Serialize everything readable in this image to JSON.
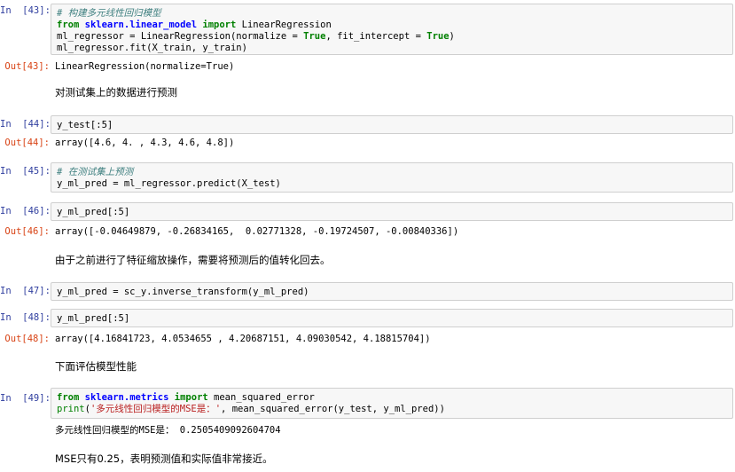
{
  "cells": {
    "c43": {
      "in_prompt": "In  [43]:",
      "line1_comment": "# 构建多元线性回归模型",
      "line2_from": "from",
      "line2_module": "sklearn.linear_model",
      "line2_import": "import",
      "line2_name": " LinearRegression",
      "line3_a": "ml_regressor = LinearRegression(normalize = ",
      "line3_true1": "True",
      "line3_b": ", fit_intercept = ",
      "line3_true2": "True",
      "line3_c": ")",
      "line4": "ml_regressor.fit(X_train, y_train)",
      "out_prompt": "Out[43]:",
      "output": "LinearRegression(normalize=True)"
    },
    "md1": "对测试集上的数据进行预测",
    "c44": {
      "in_prompt": "In  [44]:",
      "code": "y_test[:5]",
      "out_prompt": "Out[44]:",
      "output": "array([4.6, 4. , 4.3, 4.6, 4.8])"
    },
    "c45": {
      "in_prompt": "In  [45]:",
      "line1_comment": "# 在测试集上预测",
      "line2": "y_ml_pred = ml_regressor.predict(X_test)"
    },
    "c46": {
      "in_prompt": "In  [46]:",
      "code": "y_ml_pred[:5]",
      "out_prompt": "Out[46]:",
      "output": "array([-0.04649879, -0.26834165,  0.02771328, -0.19724507, -0.00840336])"
    },
    "md2": "由于之前进行了特征缩放操作，需要将预测后的值转化回去。",
    "c47": {
      "in_prompt": "In  [47]:",
      "code": "y_ml_pred = sc_y.inverse_transform(y_ml_pred)"
    },
    "c48": {
      "in_prompt": "In  [48]:",
      "code": "y_ml_pred[:5]",
      "out_prompt": "Out[48]:",
      "output": "array([4.16841723, 4.0534655 , 4.20687151, 4.09030542, 4.18815704])"
    },
    "md3": "下面评估模型性能",
    "c49": {
      "in_prompt": "In  [49]:",
      "line1_from": "from",
      "line1_module": "sklearn.metrics",
      "line1_import": "import",
      "line1_name": " mean_squared_error",
      "line2_print": "print",
      "line2_open": "(",
      "line2_string": "'多元线性回归模型的MSE是：'",
      "line2_rest": ", mean_squared_error(y_test, y_ml_pred))",
      "output": "多元线性回归模型的MSE是： 0.2505409092604704"
    },
    "md4": "MSE只有0.25，表明预测值和实际值非常接近。"
  }
}
